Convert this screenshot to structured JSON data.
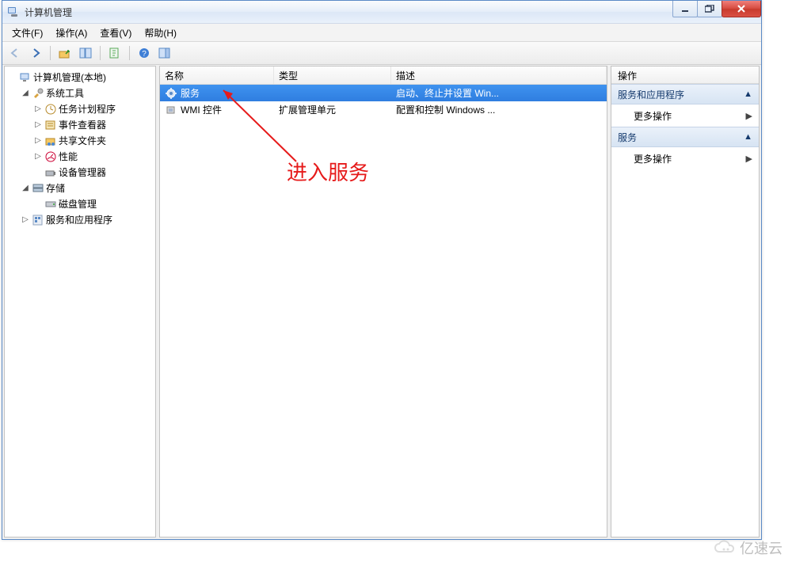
{
  "window": {
    "title": "计算机管理"
  },
  "menus": {
    "file": "文件(F)",
    "action": "操作(A)",
    "view": "查看(V)",
    "help": "帮助(H)"
  },
  "tree": {
    "root": "计算机管理(本地)",
    "system_tools": "系统工具",
    "task_scheduler": "任务计划程序",
    "event_viewer": "事件查看器",
    "shared_folders": "共享文件夹",
    "performance": "性能",
    "device_manager": "设备管理器",
    "storage": "存储",
    "disk_management": "磁盘管理",
    "services_apps": "服务和应用程序"
  },
  "list": {
    "columns": {
      "name": "名称",
      "type": "类型",
      "desc": "描述"
    },
    "rows": [
      {
        "icon": "gear",
        "name": "服务",
        "type": "",
        "desc": "启动、终止并设置 Win...",
        "selected": true
      },
      {
        "icon": "cube",
        "name": "WMI 控件",
        "type": "扩展管理单元",
        "desc": "配置和控制 Windows ...",
        "selected": false
      }
    ]
  },
  "actions": {
    "header": "操作",
    "section1": "服务和应用程序",
    "more1": "更多操作",
    "section2": "服务",
    "more2": "更多操作"
  },
  "annotation": {
    "text": "进入服务"
  },
  "watermark": {
    "text": "亿速云"
  }
}
